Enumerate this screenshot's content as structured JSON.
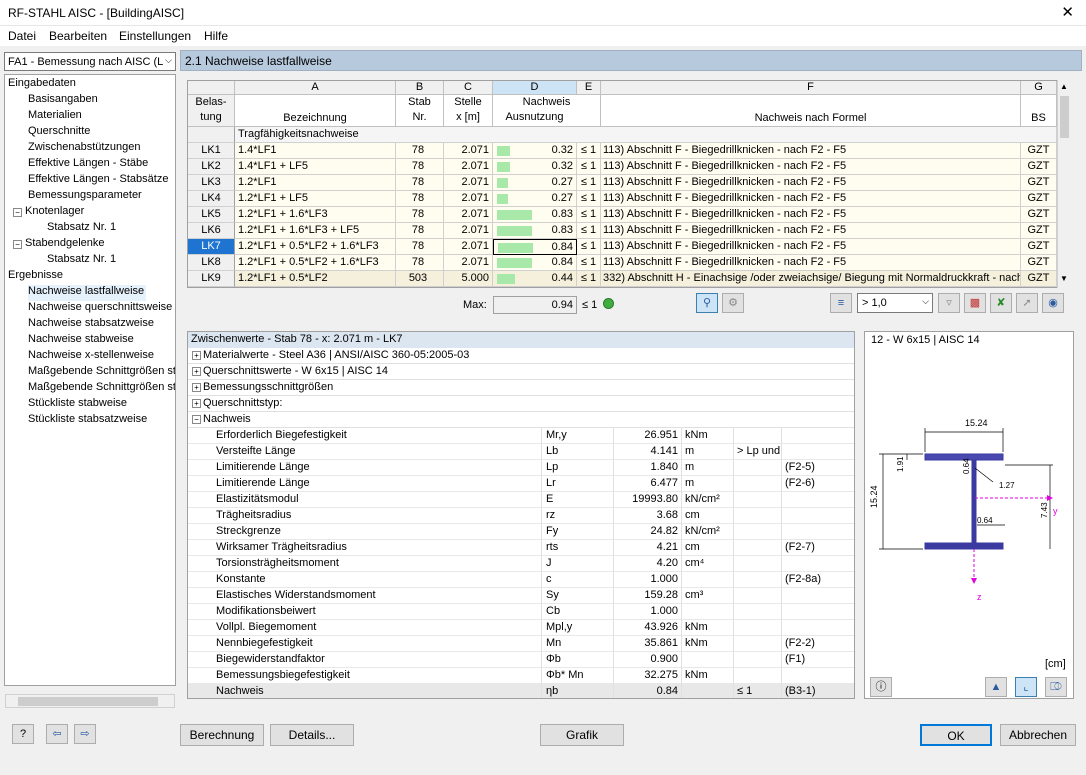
{
  "window": {
    "title": "RF-STAHL AISC - [BuildingAISC]",
    "close": "✕"
  },
  "menu": [
    "Datei",
    "Bearbeiten",
    "Einstellungen",
    "Hilfe"
  ],
  "case_select": "FA1 - Bemessung nach AISC (LR",
  "tree": {
    "in_label": "Eingabedaten",
    "items_in": [
      "Basisangaben",
      "Materialien",
      "Querschnitte",
      "Zwischenabstützungen",
      "Effektive Längen - Stäbe",
      "Effektive Längen - Stabsätze",
      "Bemessungsparameter",
      "Knotenlager",
      "Stabsatz Nr. 1",
      "Stabendgelenke",
      "Stabsatz Nr. 1"
    ],
    "out_label": "Ergebnisse",
    "items_out": [
      "Nachweise lastfallweise",
      "Nachweise querschnittsweise",
      "Nachweise stabsatzweise",
      "Nachweise stabweise",
      "Nachweise x-stellenweise",
      "Maßgebende Schnittgrößen sta",
      "Maßgebende Schnittgrößen sta",
      "Stückliste stabweise",
      "Stückliste stabsatzweise"
    ]
  },
  "panel_title": "2.1 Nachweise lastfallweise",
  "table": {
    "col_letters": [
      "A",
      "B",
      "C",
      "D",
      "E",
      "F",
      "G"
    ],
    "h_row": [
      "Belas-",
      "tung"
    ],
    "h_bez": "Bezeichnung",
    "h_stab": [
      "Stab",
      "Nr."
    ],
    "h_stelle": [
      "Stelle",
      "x [m]"
    ],
    "h_nachweis": [
      "Nachweis",
      "Ausnutzung"
    ],
    "h_formel": "Nachweis nach Formel",
    "h_bs": "BS",
    "group": "Tragfähigkeitsnachweise",
    "rows": [
      {
        "lk": "LK1",
        "bez": "1.4*LF1",
        "stab": "78",
        "x": "2.071",
        "aus": "0.32",
        "le": "≤ 1",
        "formel": "113) Abschnitt F - Biegedrillknicken - nach F2 - F5",
        "bs": "GZT",
        "f": 0.32
      },
      {
        "lk": "LK2",
        "bez": "1.4*LF1 + LF5",
        "stab": "78",
        "x": "2.071",
        "aus": "0.32",
        "le": "≤ 1",
        "formel": "113) Abschnitt F - Biegedrillknicken - nach F2 - F5",
        "bs": "GZT",
        "f": 0.32
      },
      {
        "lk": "LK3",
        "bez": "1.2*LF1",
        "stab": "78",
        "x": "2.071",
        "aus": "0.27",
        "le": "≤ 1",
        "formel": "113) Abschnitt F - Biegedrillknicken - nach F2 - F5",
        "bs": "GZT",
        "f": 0.27
      },
      {
        "lk": "LK4",
        "bez": "1.2*LF1 + LF5",
        "stab": "78",
        "x": "2.071",
        "aus": "0.27",
        "le": "≤ 1",
        "formel": "113) Abschnitt F - Biegedrillknicken - nach F2 - F5",
        "bs": "GZT",
        "f": 0.27
      },
      {
        "lk": "LK5",
        "bez": "1.2*LF1 + 1.6*LF3",
        "stab": "78",
        "x": "2.071",
        "aus": "0.83",
        "le": "≤ 1",
        "formel": "113) Abschnitt F - Biegedrillknicken - nach F2 - F5",
        "bs": "GZT",
        "f": 0.83
      },
      {
        "lk": "LK6",
        "bez": "1.2*LF1 + 1.6*LF3 + LF5",
        "stab": "78",
        "x": "2.071",
        "aus": "0.83",
        "le": "≤ 1",
        "formel": "113) Abschnitt F - Biegedrillknicken - nach F2 - F5",
        "bs": "GZT",
        "f": 0.83
      },
      {
        "lk": "LK7",
        "bez": "1.2*LF1 + 0.5*LF2 + 1.6*LF3",
        "stab": "78",
        "x": "2.071",
        "aus": "0.84",
        "le": "≤ 1",
        "formel": "113) Abschnitt F - Biegedrillknicken - nach F2 - F5",
        "bs": "GZT",
        "f": 0.84
      },
      {
        "lk": "LK8",
        "bez": "1.2*LF1 + 0.5*LF2 + 1.6*LF3",
        "stab": "78",
        "x": "2.071",
        "aus": "0.84",
        "le": "≤ 1",
        "formel": "113) Abschnitt F - Biegedrillknicken - nach F2 - F5",
        "bs": "GZT",
        "f": 0.84
      },
      {
        "lk": "LK9",
        "bez": "1.2*LF1 + 0.5*LF2",
        "stab": "503",
        "x": "5.000",
        "aus": "0.44",
        "le": "≤ 1",
        "formel": "332) Abschnitt H - Einachsige /oder zweiachsige/ Biegung mit Normaldruckkraft - nach",
        "bs": "GZT",
        "f": 0.44
      }
    ],
    "max_label": "Max:",
    "max_value": "0.94",
    "max_le": "≤ 1",
    "filter": "> 1,0"
  },
  "zw": {
    "title": "Zwischenwerte - Stab 78 - x: 2.071 m - LK7",
    "groups": [
      "Materialwerte - Steel A36 | ANSI/AISC 360-05:2005-03",
      "Querschnittswerte  -  W 6x15 | AISC 14",
      "Bemessungsschnittgrößen",
      "Querschnittstyp:",
      "Nachweis"
    ],
    "rows": [
      {
        "n": "Erforderlich Biegefestigkeit",
        "s": "Mr,y",
        "v": "26.951",
        "u": "kNm",
        "e": "",
        "r": ""
      },
      {
        "n": "Versteifte Länge",
        "s": "Lb",
        "v": "4.141",
        "u": "m",
        "e": "> Lp und",
        "r": ""
      },
      {
        "n": "Limitierende Länge",
        "s": "Lp",
        "v": "1.840",
        "u": "m",
        "e": "",
        "r": "(F2-5)"
      },
      {
        "n": "Limitierende Länge",
        "s": "Lr",
        "v": "6.477",
        "u": "m",
        "e": "",
        "r": "(F2-6)"
      },
      {
        "n": "Elastizitätsmodul",
        "s": "E",
        "v": "19993.80",
        "u": "kN/cm²",
        "e": "",
        "r": ""
      },
      {
        "n": "Trägheitsradius",
        "s": "rz",
        "v": "3.68",
        "u": "cm",
        "e": "",
        "r": ""
      },
      {
        "n": "Streckgrenze",
        "s": "Fy",
        "v": "24.82",
        "u": "kN/cm²",
        "e": "",
        "r": ""
      },
      {
        "n": "Wirksamer Trägheitsradius",
        "s": "rts",
        "v": "4.21",
        "u": "cm",
        "e": "",
        "r": "(F2-7)"
      },
      {
        "n": "Torsionsträgheitsmoment",
        "s": "J",
        "v": "4.20",
        "u": "cm⁴",
        "e": "",
        "r": ""
      },
      {
        "n": "Konstante",
        "s": "c",
        "v": "1.000",
        "u": "",
        "e": "",
        "r": "(F2-8a)"
      },
      {
        "n": "Elastisches Widerstandsmoment",
        "s": "Sy",
        "v": "159.28",
        "u": "cm³",
        "e": "",
        "r": ""
      },
      {
        "n": "Modifikationsbeiwert",
        "s": "Cb",
        "v": "1.000",
        "u": "",
        "e": "",
        "r": ""
      },
      {
        "n": "Vollpl. Biegemoment",
        "s": "Mpl,y",
        "v": "43.926",
        "u": "kNm",
        "e": "",
        "r": ""
      },
      {
        "n": "Nennbiegefestigkeit",
        "s": "Mn",
        "v": "35.861",
        "u": "kNm",
        "e": "",
        "r": "(F2-2)"
      },
      {
        "n": "Biegewiderstandfaktor",
        "s": "Φb",
        "v": "0.900",
        "u": "",
        "e": "",
        "r": "(F1)"
      },
      {
        "n": "Bemessungsbiegefestigkeit",
        "s": "Φb* Mn",
        "v": "32.275",
        "u": "kNm",
        "e": "",
        "r": ""
      },
      {
        "n": "Nachweis",
        "s": "ηb",
        "v": "0.84",
        "u": "",
        "e": "≤ 1",
        "r": "(B3-1)"
      }
    ]
  },
  "graphic": {
    "title": "12 - W 6x15 | AISC 14",
    "dim_top": "15.24",
    "dim_left": "15.24",
    "dim_191": "1.91",
    "dim_064a": "0.64",
    "dim_127": "1.27",
    "dim_064b": "0.64",
    "dim_743": "7.43",
    "axis_y": "y",
    "axis_z": "z",
    "unit": "[cm]"
  },
  "buttons": {
    "berechnung": "Berechnung",
    "details": "Details...",
    "grafik": "Grafik",
    "ok": "OK",
    "abbrechen": "Abbrechen"
  }
}
